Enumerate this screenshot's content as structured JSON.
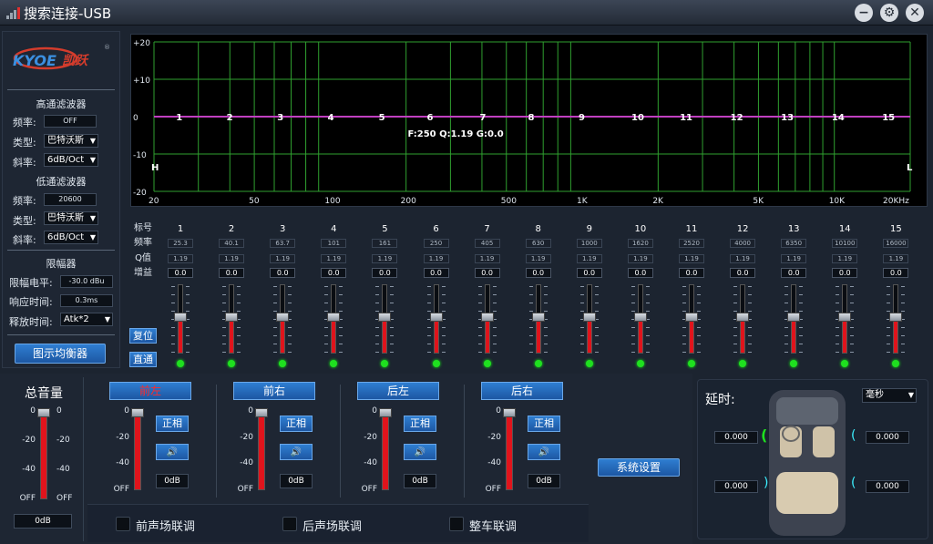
{
  "window": {
    "title": "搜索连接-USB"
  },
  "logo": {
    "brand_en": "KYOE",
    "brand_cn": "凯跃"
  },
  "highpass": {
    "title": "高通滤波器",
    "freq_label": "频率:",
    "freq_value": "OFF",
    "type_label": "类型:",
    "type_value": "巴特沃斯",
    "slope_label": "斜率:",
    "slope_value": "6dB/Oct"
  },
  "lowpass": {
    "title": "低通滤波器",
    "freq_label": "频率:",
    "freq_value": "20600",
    "type_label": "类型:",
    "type_value": "巴特沃斯",
    "slope_label": "斜率:",
    "slope_value": "6dB/Oct"
  },
  "limiter": {
    "title": "限幅器",
    "level_label": "限幅电平:",
    "level_value": "-30.0 dBu",
    "attack_label": "响应时间:",
    "attack_value": "0.3ms",
    "release_label": "释放时间:",
    "release_value": "Atk*2"
  },
  "graphic_eq_button": "图示均衡器",
  "graph": {
    "y_ticks": [
      "+20",
      "+10",
      "0",
      "-10",
      "-20"
    ],
    "x_ticks": [
      "20",
      "50",
      "100",
      "200",
      "500",
      "1K",
      "2K",
      "5K",
      "10K",
      "20KHz"
    ],
    "band_markers": [
      "1",
      "2",
      "3",
      "4",
      "5",
      "6",
      "7",
      "8",
      "9",
      "10",
      "11",
      "12",
      "13",
      "14",
      "15"
    ],
    "readout": "F:250 Q:1.19 G:0.0",
    "hp_marker": "H",
    "lp_marker": "L",
    "curve_color": "#c040c0",
    "grid_color": "#2fa02f"
  },
  "eq": {
    "row_labels": {
      "num": "标号",
      "freq": "频率",
      "q": "Q值",
      "gain": "增益"
    },
    "reset_button": "复位",
    "bypass_button": "直通",
    "bands": [
      {
        "num": "1",
        "freq": "25.3",
        "q": "1.19",
        "gain": "0.0"
      },
      {
        "num": "2",
        "freq": "40.1",
        "q": "1.19",
        "gain": "0.0"
      },
      {
        "num": "3",
        "freq": "63.7",
        "q": "1.19",
        "gain": "0.0"
      },
      {
        "num": "4",
        "freq": "101",
        "q": "1.19",
        "gain": "0.0"
      },
      {
        "num": "5",
        "freq": "161",
        "q": "1.19",
        "gain": "0.0"
      },
      {
        "num": "6",
        "freq": "250",
        "q": "1.19",
        "gain": "0.0"
      },
      {
        "num": "7",
        "freq": "405",
        "q": "1.19",
        "gain": "0.0"
      },
      {
        "num": "8",
        "freq": "630",
        "q": "1.19",
        "gain": "0.0"
      },
      {
        "num": "9",
        "freq": "1000",
        "q": "1.19",
        "gain": "0.0"
      },
      {
        "num": "10",
        "freq": "1620",
        "q": "1.19",
        "gain": "0.0"
      },
      {
        "num": "11",
        "freq": "2520",
        "q": "1.19",
        "gain": "0.0"
      },
      {
        "num": "12",
        "freq": "4000",
        "q": "1.19",
        "gain": "0.0"
      },
      {
        "num": "13",
        "freq": "6350",
        "q": "1.19",
        "gain": "0.0"
      },
      {
        "num": "14",
        "freq": "10100",
        "q": "1.19",
        "gain": "0.0"
      },
      {
        "num": "15",
        "freq": "16000",
        "q": "1.19",
        "gain": "0.0"
      }
    ]
  },
  "master": {
    "title": "总音量",
    "scale": [
      "0",
      "-20",
      "-40",
      "OFF"
    ],
    "value": "0dB",
    "level_fraction": 1.0
  },
  "channels": [
    {
      "name": "前左",
      "selected": true,
      "phase_label": "正相",
      "value": "0dB",
      "scale": [
        "0",
        "-20",
        "-40",
        "OFF"
      ],
      "level_fraction": 1.0
    },
    {
      "name": "前右",
      "selected": false,
      "phase_label": "正相",
      "value": "0dB",
      "scale": [
        "0",
        "-20",
        "-40",
        "OFF"
      ],
      "level_fraction": 1.0
    },
    {
      "name": "后左",
      "selected": false,
      "phase_label": "正相",
      "value": "0dB",
      "scale": [
        "0",
        "-20",
        "-40",
        "OFF"
      ],
      "level_fraction": 1.0
    },
    {
      "name": "后右",
      "selected": false,
      "phase_label": "正相",
      "value": "0dB",
      "scale": [
        "0",
        "-20",
        "-40",
        "OFF"
      ],
      "level_fraction": 1.0
    }
  ],
  "system_settings_button": "系统设置",
  "links": {
    "front": "前声场联调",
    "rear": "后声场联调",
    "all": "整车联调"
  },
  "delay": {
    "title": "延时:",
    "unit": "毫秒",
    "front_left": "0.000",
    "front_right": "0.000",
    "rear_left": "0.000",
    "rear_right": "0.000"
  }
}
